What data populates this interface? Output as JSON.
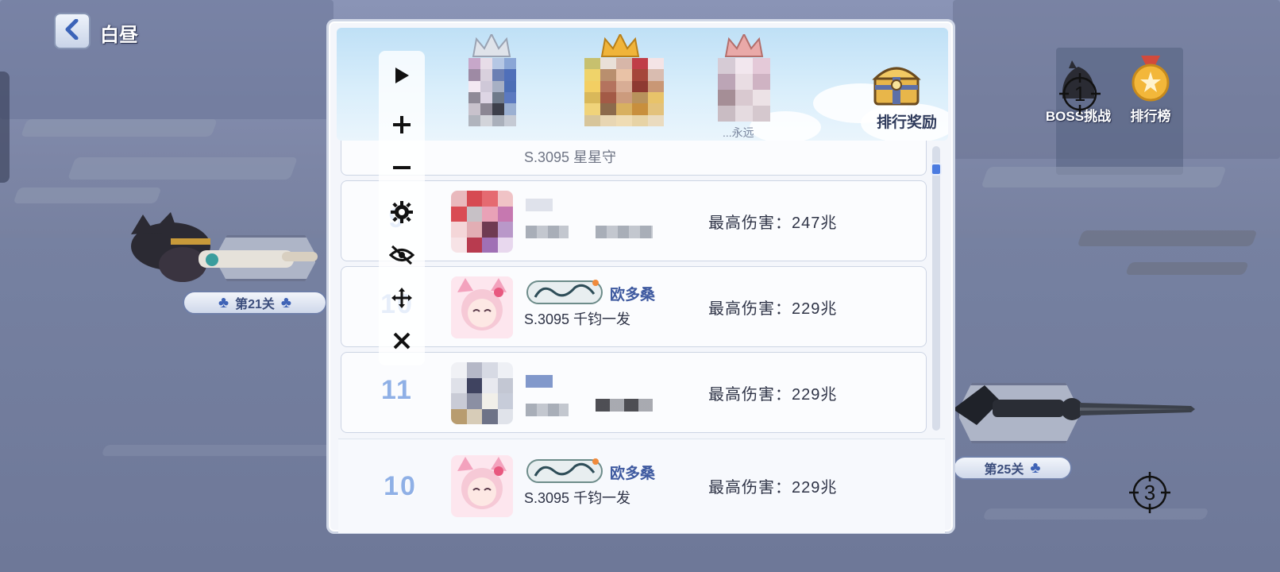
{
  "header": {
    "stage_name": "白昼"
  },
  "stage_plates": {
    "left": "第21关",
    "right": "第25关"
  },
  "side_menu": {
    "boss_label": "BOSS挑战",
    "boss_marker": "1",
    "ranking_label": "排行榜",
    "bottom_marker": "3"
  },
  "panel": {
    "reward_label": "排行奖励",
    "podium_third_suffix": "...永远",
    "partial_row_text": "S.3095 星星守",
    "rows": [
      {
        "rank": "9",
        "server": "",
        "player_name": "",
        "damage": "最高伤害：247兆"
      },
      {
        "rank": "10",
        "server": "S.3095 千钧一发",
        "player_name": "欧多桑",
        "damage": "最高伤害：229兆"
      },
      {
        "rank": "11",
        "server": "",
        "player_name": "",
        "damage": "最高伤害：229兆"
      }
    ],
    "my_row": {
      "rank": "10",
      "server": "S.3095 千钧一发",
      "player_name": "欧多桑",
      "damage": "最高伤害：229兆"
    },
    "scroll_position": 0.06
  },
  "toolbar": {
    "icons": [
      "play-icon",
      "plus-icon",
      "minus-icon",
      "gear-icon",
      "eye-off-icon",
      "move-icon",
      "close-icon"
    ]
  },
  "colors": {
    "rank_blue": "#8fb0e6",
    "name_blue": "#3f5aa0",
    "scroll_thumb": "#4b7be0",
    "gold_crown": "#f0b43a"
  }
}
